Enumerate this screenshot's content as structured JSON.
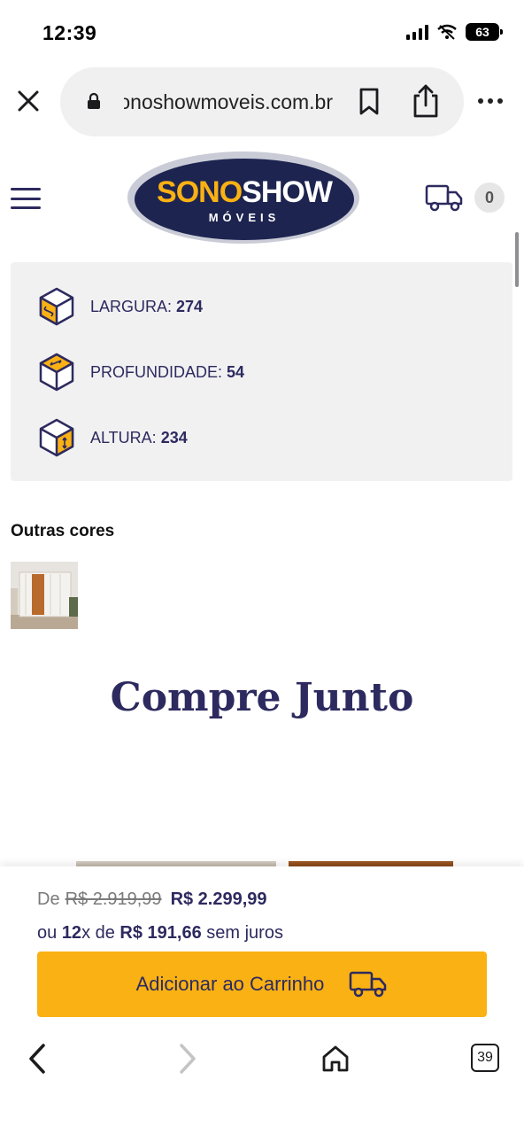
{
  "status_bar": {
    "time": "12:39",
    "battery": "63"
  },
  "browser": {
    "url": "sonoshowmoveis.com.br",
    "tab_count": "39"
  },
  "header": {
    "logo_main_1": "SONO",
    "logo_main_2": "SHOW",
    "logo_sub": "MÓVEIS",
    "cart_count": "0"
  },
  "dimensions": [
    {
      "label": "LARGURA: ",
      "value": "274",
      "icon": "box-width-icon"
    },
    {
      "label": "PROFUNDIDADE: ",
      "value": "54",
      "icon": "box-depth-icon"
    },
    {
      "label": "ALTURA: ",
      "value": "234",
      "icon": "box-height-icon"
    }
  ],
  "other_colors": {
    "title": "Outras cores"
  },
  "compre_junto": {
    "title": "Compre Junto"
  },
  "purchase": {
    "de_label": "De",
    "old_price": "R$ 2.919,99",
    "new_price": "R$ 2.299,99",
    "install_prefix": "ou ",
    "install_count": "12",
    "install_mid": "x de ",
    "install_value": "R$ 191,66",
    "install_suffix": " sem juros",
    "add_to_cart": "Adicionar ao Carrinho"
  },
  "colors": {
    "brand_navy": "#2d2a5f",
    "brand_yellow": "#f9b114",
    "panel_gray": "#f1f1f2"
  }
}
